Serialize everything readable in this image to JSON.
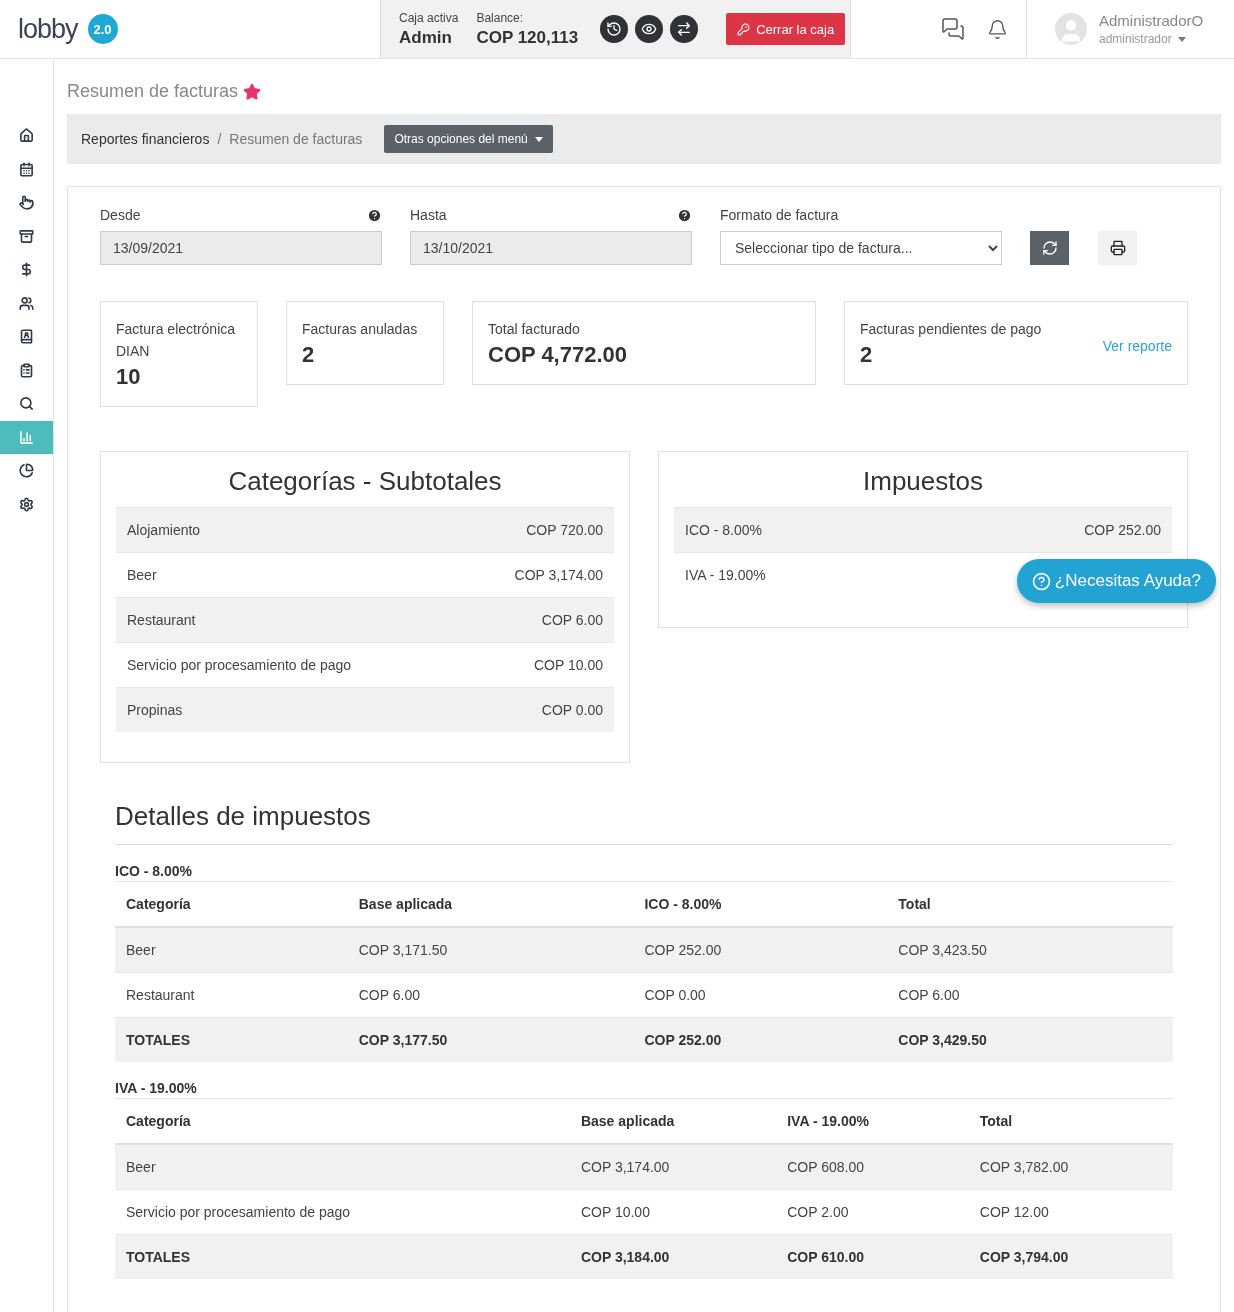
{
  "header": {
    "logo": "lobby",
    "version": "2.0",
    "caja": {
      "label": "Caja activa",
      "value": "Admin"
    },
    "balance": {
      "label": "Balance:",
      "value": "COP 120,113"
    },
    "close_button": "Cerrar la caja",
    "user": {
      "name": "AdministradorO",
      "role": "administrador"
    }
  },
  "sidebar": {
    "items": [
      {
        "selected": false
      },
      {
        "selected": false
      },
      {
        "selected": false
      },
      {
        "selected": false
      },
      {
        "selected": false
      },
      {
        "selected": false
      },
      {
        "selected": false
      },
      {
        "selected": false
      },
      {
        "selected": false
      },
      {
        "selected": true
      },
      {
        "selected": false
      },
      {
        "selected": false
      }
    ]
  },
  "page": {
    "title": "Resumen de facturas",
    "favorite": true
  },
  "breadcrumb": {
    "items": [
      "Reportes financieros",
      "Resumen de facturas"
    ],
    "separator": "/",
    "menu_button": "Otras opciones del menú"
  },
  "filters": {
    "desde": {
      "label": "Desde",
      "value": "13/09/2021"
    },
    "hasta": {
      "label": "Hasta",
      "value": "13/10/2021"
    },
    "formato": {
      "label": "Formato de factura",
      "placeholder": "Seleccionar tipo de factura..."
    }
  },
  "stats": [
    {
      "title": "Factura electrónica DIAN",
      "value": "10"
    },
    {
      "title": "Facturas anuladas",
      "value": "2"
    },
    {
      "title": "Total facturado",
      "value": "COP 4,772.00"
    },
    {
      "title": "Facturas pendientes de pago",
      "value": "2",
      "link": "Ver reporte"
    }
  ],
  "categorias": {
    "title": "Categorías - Subtotales",
    "rows": [
      {
        "name": "Alojamiento",
        "amount": "COP 720.00"
      },
      {
        "name": "Beer",
        "amount": "COP 3,174.00"
      },
      {
        "name": "Restaurant",
        "amount": "COP 6.00"
      },
      {
        "name": "Servicio por procesamiento de pago",
        "amount": "COP 10.00"
      },
      {
        "name": "Propinas",
        "amount": "COP 0.00"
      }
    ]
  },
  "impuestos": {
    "title": "Impuestos",
    "rows": [
      {
        "name": "ICO - 8.00%",
        "amount": "COP 252.00"
      },
      {
        "name": "IVA - 19.00%"
      }
    ]
  },
  "detalles": {
    "title": "Detalles de impuestos",
    "sections": [
      {
        "title": "ICO - 8.00%",
        "columns": [
          "Categoría",
          "Base aplicada",
          "ICO - 8.00%",
          "Total"
        ],
        "rows": [
          {
            "kind": "item",
            "cells": [
              "Beer",
              "COP 3,171.50",
              "COP 252.00",
              "COP 3,423.50"
            ]
          },
          {
            "kind": "item",
            "cells": [
              "Restaurant",
              "COP 6.00",
              "COP 0.00",
              "COP 6.00"
            ]
          },
          {
            "kind": "total",
            "cells": [
              "TOTALES",
              "COP 3,177.50",
              "COP 252.00",
              "COP 3,429.50"
            ]
          }
        ]
      },
      {
        "title": "IVA - 19.00%",
        "columns": [
          "Categoría",
          "Base aplicada",
          "IVA - 19.00%",
          "Total"
        ],
        "rows": [
          {
            "kind": "item",
            "cells": [
              "Beer",
              "COP 3,174.00",
              "COP 608.00",
              "COP 3,782.00"
            ]
          },
          {
            "kind": "item",
            "cells": [
              "Servicio por procesamiento de pago",
              "COP 10.00",
              "COP 2.00",
              "COP 12.00"
            ]
          },
          {
            "kind": "total",
            "cells": [
              "TOTALES",
              "COP 3,184.00",
              "COP 610.00",
              "COP 3,794.00"
            ]
          }
        ]
      }
    ]
  },
  "help_button": "¿Necesitas Ayuda?"
}
